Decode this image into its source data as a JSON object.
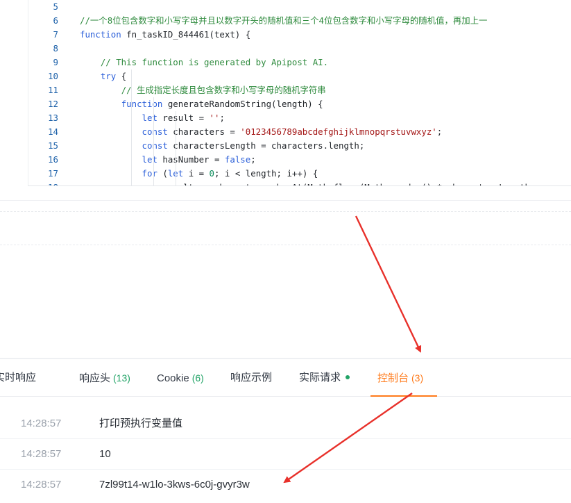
{
  "editor": {
    "lines": [
      {
        "n": "5",
        "parts": []
      },
      {
        "n": "6",
        "parts": [
          {
            "c": "tok-comment",
            "t": "//一个8位包含数字和小写字母并且以数字开头的随机值和三个4位包含数字和小写字母的随机值，再加上一"
          }
        ]
      },
      {
        "n": "7",
        "parts": [
          {
            "c": "tok-kw",
            "t": "function "
          },
          {
            "c": "",
            "t": "fn_taskID_844461(text) {"
          }
        ]
      },
      {
        "n": "8",
        "parts": []
      },
      {
        "n": "9",
        "parts": [
          {
            "c": "",
            "t": "    "
          },
          {
            "c": "tok-comment",
            "t": "// This function is generated by Apipost AI."
          }
        ]
      },
      {
        "n": "10",
        "parts": [
          {
            "c": "",
            "t": "    "
          },
          {
            "c": "tok-kw",
            "t": "try"
          },
          {
            "c": "",
            "t": " {"
          }
        ]
      },
      {
        "n": "11",
        "parts": [
          {
            "c": "",
            "t": "        "
          },
          {
            "c": "tok-comment",
            "t": "// 生成指定长度且包含数字和小写字母的随机字符串"
          }
        ]
      },
      {
        "n": "12",
        "parts": [
          {
            "c": "",
            "t": "        "
          },
          {
            "c": "tok-kw",
            "t": "function "
          },
          {
            "c": "",
            "t": "generateRandomString(length) {"
          }
        ]
      },
      {
        "n": "13",
        "parts": [
          {
            "c": "",
            "t": "            "
          },
          {
            "c": "tok-kw",
            "t": "let"
          },
          {
            "c": "",
            "t": " result = "
          },
          {
            "c": "tok-str",
            "t": "''"
          },
          {
            "c": "",
            "t": ";"
          }
        ]
      },
      {
        "n": "14",
        "parts": [
          {
            "c": "",
            "t": "            "
          },
          {
            "c": "tok-kw",
            "t": "const"
          },
          {
            "c": "",
            "t": " characters = "
          },
          {
            "c": "tok-str",
            "t": "'0123456789abcdefghijklmnopqrstuvwxyz'"
          },
          {
            "c": "",
            "t": ";"
          }
        ]
      },
      {
        "n": "15",
        "parts": [
          {
            "c": "",
            "t": "            "
          },
          {
            "c": "tok-kw",
            "t": "const"
          },
          {
            "c": "",
            "t": " charactersLength = characters.length;"
          }
        ]
      },
      {
        "n": "16",
        "parts": [
          {
            "c": "",
            "t": "            "
          },
          {
            "c": "tok-kw",
            "t": "let"
          },
          {
            "c": "",
            "t": " hasNumber = "
          },
          {
            "c": "tok-kw",
            "t": "false"
          },
          {
            "c": "",
            "t": ";"
          }
        ]
      },
      {
        "n": "17",
        "parts": [
          {
            "c": "",
            "t": "            "
          },
          {
            "c": "tok-kw",
            "t": "for"
          },
          {
            "c": "",
            "t": " ("
          },
          {
            "c": "tok-kw",
            "t": "let"
          },
          {
            "c": "",
            "t": " i = "
          },
          {
            "c": "tok-num",
            "t": "0"
          },
          {
            "c": "",
            "t": "; i < length; i++) {"
          }
        ]
      },
      {
        "n": "18",
        "parts": [
          {
            "c": "",
            "t": "                result += characters.charAt(Math.floor(Math.random() * charactersLength"
          }
        ]
      }
    ]
  },
  "tabs": [
    {
      "label": "实时响应",
      "count": "",
      "dot": false,
      "active": false
    },
    {
      "label": "响应头",
      "count": "(13)",
      "dot": false,
      "active": false
    },
    {
      "label": "Cookie",
      "count": "(6)",
      "dot": false,
      "active": false
    },
    {
      "label": "响应示例",
      "count": "",
      "dot": false,
      "active": false
    },
    {
      "label": "实际请求",
      "count": "",
      "dot": true,
      "active": false
    },
    {
      "label": "控制台",
      "count": "(3)",
      "dot": false,
      "active": true
    }
  ],
  "console": [
    {
      "time": "14:28:57",
      "message": "打印预执行变量值"
    },
    {
      "time": "14:28:57",
      "message": "10"
    },
    {
      "time": "14:28:57",
      "message": "7zl99t14-w1lo-3kws-6c0j-gvyr3w"
    }
  ],
  "colors": {
    "accent": "#ff7a1a",
    "green": "#21a366",
    "arrow": "#e8302a"
  }
}
